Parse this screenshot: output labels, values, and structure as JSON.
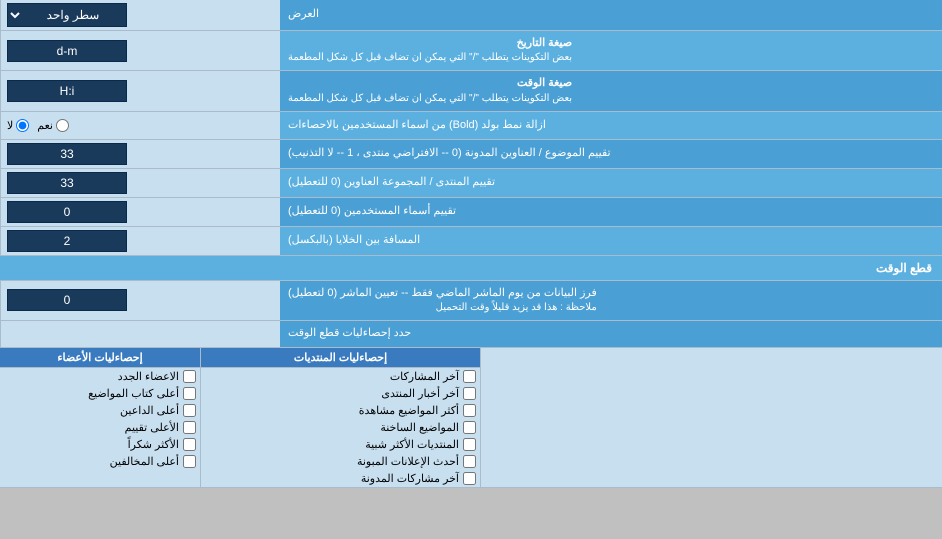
{
  "page": {
    "display_mode_label": "العرض",
    "display_mode_value": "سطر واحد",
    "date_format_section": {
      "label1": "صيغة التاريخ",
      "label2": "بعض التكوينات يتطلب \"/\" التي يمكن ان تضاف قبل كل شكل المطعمة",
      "value": "d-m"
    },
    "time_format_section": {
      "label1": "صيغة الوقت",
      "label2": "بعض التكوينات يتطلب \"/\" التي يمكن ان تضاف قبل كل شكل المطعمة",
      "value": "H:i"
    },
    "bold_remove": {
      "label": "ازالة نمط بولد (Bold) من اسماء المستخدمين بالاحصاءات",
      "option_yes": "نعم",
      "option_no": "لا"
    },
    "topics_sort": {
      "label": "تقييم الموضوع / العناوين المدونة (0 -- الافتراضي منتدى ، 1 -- لا التذنيب)",
      "value": "33"
    },
    "forum_sort": {
      "label": "تقييم المنتدى / المجموعة العناوين (0 للتعطيل)",
      "value": "33"
    },
    "users_sort": {
      "label": "تقييم أسماء المستخدمين (0 للتعطيل)",
      "value": "0"
    },
    "cell_gap": {
      "label": "المسافة بين الخلايا (بالبكسل)",
      "value": "2"
    },
    "time_cut_section": "قطع الوقت",
    "time_cut": {
      "label1": "فرز البيانات من يوم الماشر الماضي فقط -- تعيين الماشر (0 لتعطيل)",
      "label2": "ملاحظة : هذا قد يزيد قليلاً وقت التحميل",
      "value": "0"
    },
    "stats_apply_label": "حدد إحصاءليات قطع الوقت",
    "stats_columns": {
      "col1_header": "إحصاءليات الأعضاء",
      "col2_header": "إحصاءليات المنتديات",
      "col3_header": ""
    },
    "col1_items": [
      {
        "label": "الاعضاء الجدد",
        "checked": false
      },
      {
        "label": "أعلى كتاب المواضيع",
        "checked": false
      },
      {
        "label": "أعلى الداعين",
        "checked": false
      },
      {
        "label": "الأعلى تقييم",
        "checked": false
      },
      {
        "label": "الأكثر شكراً",
        "checked": false
      },
      {
        "label": "أعلى المخالفين",
        "checked": false
      }
    ],
    "col2_items": [
      {
        "label": "آخر المشاركات",
        "checked": false
      },
      {
        "label": "آخر أخبار المنتدى",
        "checked": false
      },
      {
        "label": "أكثر المواضيع مشاهدة",
        "checked": false
      },
      {
        "label": "المواضيع الساخنة",
        "checked": false
      },
      {
        "label": "المنتديات الأكثر شبية",
        "checked": false
      },
      {
        "label": "أحدث الإعلانات المبونة",
        "checked": false
      },
      {
        "label": "آخر مشاركات المدونة",
        "checked": false
      }
    ]
  }
}
